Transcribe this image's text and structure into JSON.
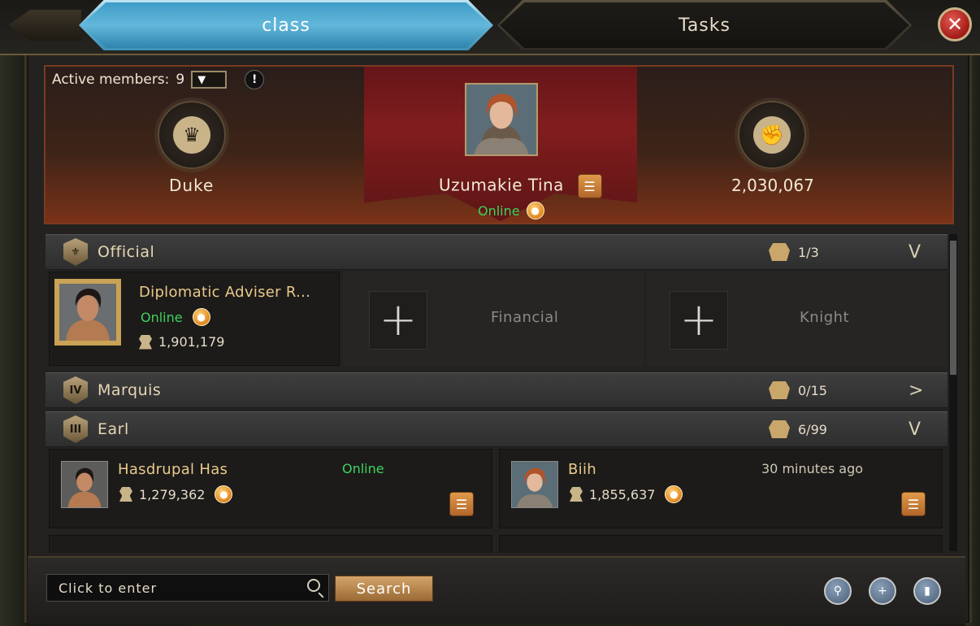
{
  "tabs": {
    "class_label": "class",
    "tasks_label": "Tasks"
  },
  "header": {
    "active_members_label": "Active members:",
    "active_members_count": "9",
    "rank_title": "Duke",
    "leader_name": "Uzumakie Tina",
    "leader_status": "Online",
    "power_value": "2,030,067"
  },
  "sections": {
    "official": {
      "label": "Official",
      "count": "1/3",
      "toggle": "V"
    },
    "marquis": {
      "label": "Marquis",
      "count": "0/15",
      "toggle": ">",
      "numeral": "IV"
    },
    "earl": {
      "label": "Earl",
      "count": "6/99",
      "toggle": "V",
      "numeral": "III"
    }
  },
  "official_slots": {
    "member": {
      "name": "Diplomatic Adviser R...",
      "status": "Online",
      "power": "1,901,179"
    },
    "financial_label": "Financial",
    "knight_label": "Knight"
  },
  "earl_members": [
    {
      "name": "Hasdrupal Has",
      "power": "1,279,362",
      "status": "Online"
    },
    {
      "name": "Biih",
      "power": "1,855,637",
      "status": "30 minutes ago"
    }
  ],
  "bottom": {
    "search_placeholder": "Click to enter",
    "search_button": "Search"
  },
  "colors": {
    "online": "#3ed35c",
    "accent_gold": "#e9c98a",
    "tab_active": "#4aa6d0"
  },
  "icons": [
    "close-icon",
    "filter-icon",
    "info-icon",
    "crown-icon",
    "fist-icon",
    "list-icon",
    "fire-icon",
    "helmet-icon",
    "plus-icon",
    "search-icon",
    "locate-icon",
    "add-user-icon",
    "stats-icon"
  ]
}
